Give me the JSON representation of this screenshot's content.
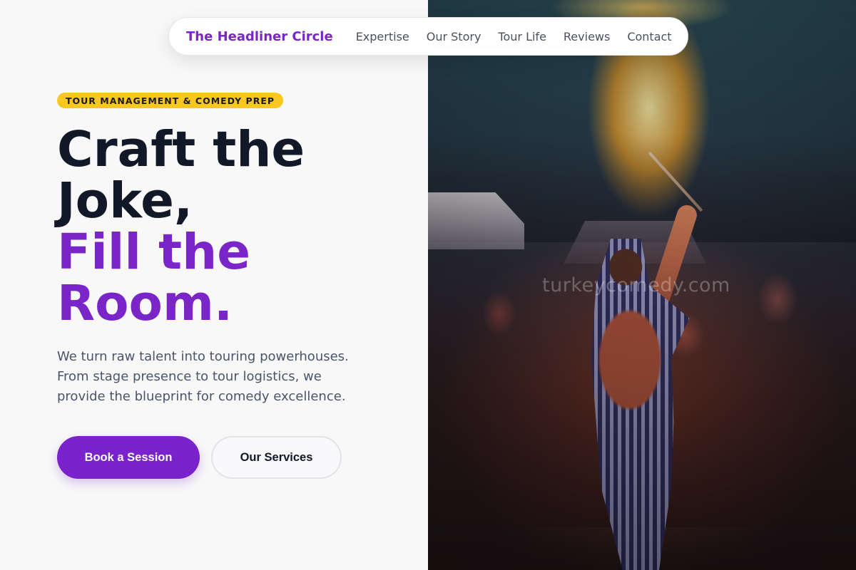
{
  "nav": {
    "brand": "The Headliner Circle",
    "links": [
      "Expertise",
      "Our Story",
      "Tour Life",
      "Reviews",
      "Contact"
    ]
  },
  "hero": {
    "badge": "TOUR MANAGEMENT & COMEDY PREP",
    "headline_line1": "Craft the",
    "headline_line2": "Joke,",
    "headline_line3": "Fill the",
    "headline_line4": "Room.",
    "description": "We turn raw talent into touring powerhouses. From stage presence to tour logistics, we provide the blueprint for comedy excellence.",
    "primary_button": "Book a Session",
    "secondary_button": "Our Services"
  },
  "image": {
    "watermark": "turkeycomedy.com"
  },
  "colors": {
    "accent": "#7a25c8",
    "badge": "#f9c820",
    "heading_dark": "#111827",
    "text_muted": "#4a5568"
  }
}
